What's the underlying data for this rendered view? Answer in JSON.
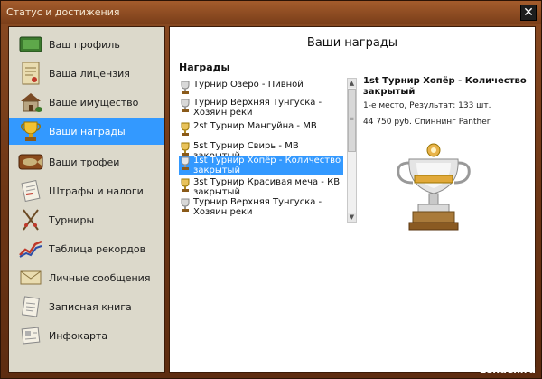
{
  "window": {
    "title": "Статус и достижения",
    "close_glyph": "✕"
  },
  "sidebar": {
    "items": [
      {
        "label": "Ваш профиль",
        "icon": "profile-card-icon",
        "active": false
      },
      {
        "label": "Ваша лицензия",
        "icon": "license-certificate-icon",
        "active": false
      },
      {
        "label": "Ваше имущество",
        "icon": "house-property-icon",
        "active": false
      },
      {
        "label": "Ваши награды",
        "icon": "trophy-icon",
        "active": true
      },
      {
        "label": "Ваши трофеи",
        "icon": "fish-trophy-icon",
        "active": false
      },
      {
        "label": "Штрафы и налоги",
        "icon": "fines-document-icon",
        "active": false
      },
      {
        "label": "Турниры",
        "icon": "crossed-rods-icon",
        "active": false
      },
      {
        "label": "Таблица рекордов",
        "icon": "records-chart-icon",
        "active": false
      },
      {
        "label": "Личные сообщения",
        "icon": "messages-envelope-icon",
        "active": false
      },
      {
        "label": "Записная книга",
        "icon": "notebook-icon",
        "active": false
      },
      {
        "label": "Инфокарта",
        "icon": "info-card-icon",
        "active": false
      }
    ]
  },
  "content": {
    "title": "Ваши награды",
    "awards_heading": "Награды",
    "awards": [
      {
        "text": "Турнир Озеро - Пивной",
        "selected": false
      },
      {
        "text": "Турнир Верхняя Тунгуска - Хозяин реки",
        "selected": false
      },
      {
        "text": "2st Турнир Мангуйна - МВ",
        "selected": false
      },
      {
        "text": "5st Турнир Свирь - МВ закрытый",
        "selected": false
      },
      {
        "text": "1st Турнир Хопёр - Количество закрытый",
        "selected": true
      },
      {
        "text": "3st Турнир Красивая меча - КВ закрытый",
        "selected": false
      },
      {
        "text": "Турнир Верхняя Тунгуска - Хозяин реки",
        "selected": false
      }
    ],
    "detail": {
      "title": "1st Турнир Хопёр - Количество закрытый",
      "line1": "1-е место, Результат: 133 шт.",
      "line2": "44 750 руб. Спиннинг Panther"
    }
  },
  "scrollbar": {
    "up": "▲",
    "down": "▼",
    "grip": "≡"
  },
  "watermark": "Lendex.ru",
  "colors": {
    "selection": "#3399ff",
    "frame": "#6e3716",
    "sidebar_bg": "#dcd9cb"
  }
}
